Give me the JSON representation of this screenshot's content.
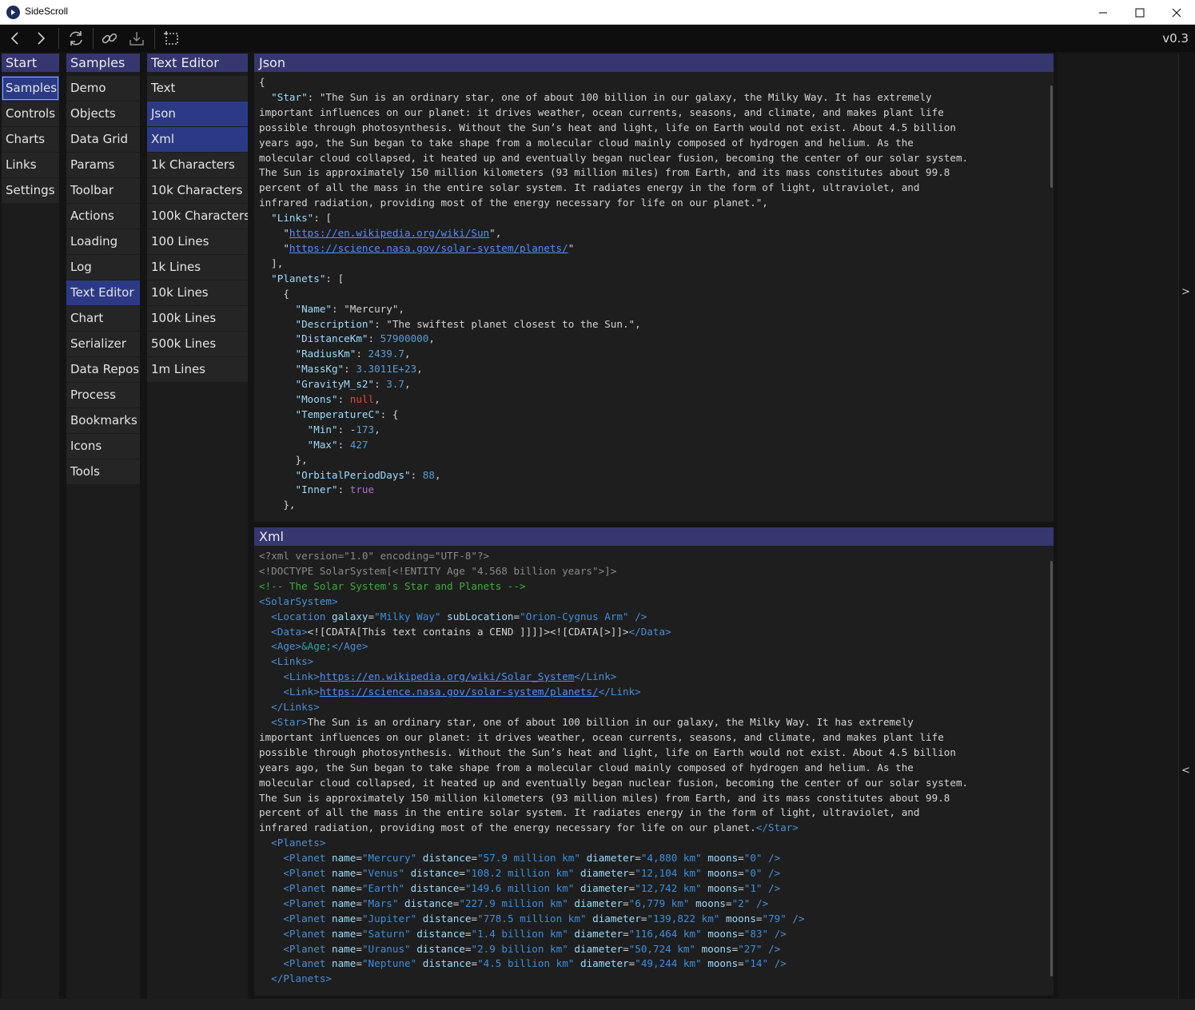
{
  "window": {
    "title": "SideScroll",
    "version": "v0.3"
  },
  "icons": {
    "app": "sidescroll-logo-icon",
    "back": "chevron-left-icon",
    "forward": "chevron-right-icon",
    "refresh": "refresh-icon",
    "link": "link-icon",
    "import": "download-icon",
    "snapshot": "crop-select-icon",
    "minimize": "minimize-icon",
    "maximize": "maximize-icon",
    "close": "close-icon"
  },
  "columns": {
    "start": {
      "title": "Start",
      "items": [
        "Samples",
        "Controls",
        "Charts",
        "Links",
        "Settings"
      ]
    },
    "samples": {
      "title": "Samples",
      "items": [
        "Demo",
        "Objects",
        "Data Grid",
        "Params",
        "Toolbar",
        "Actions",
        "Loading",
        "Log",
        "Text Editor",
        "Chart",
        "Serializer",
        "Data Repos",
        "Process",
        "Bookmarks",
        "Icons",
        "Tools"
      ]
    },
    "text_editor": {
      "title": "Text Editor",
      "items": [
        "Text",
        "Json",
        "Xml",
        "1k Characters",
        "10k Characters",
        "100k Characters",
        "100 Lines",
        "1k Lines",
        "10k Lines",
        "100k Lines",
        "500k Lines",
        "1m Lines"
      ]
    }
  },
  "json_panel": {
    "title": "Json"
  },
  "xml_panel": {
    "title": "Xml"
  },
  "nav": {
    "expand": ">",
    "collapse": "<"
  },
  "colors": {
    "header": "#363670",
    "selected": "#2c3a86",
    "background": "#141414"
  }
}
